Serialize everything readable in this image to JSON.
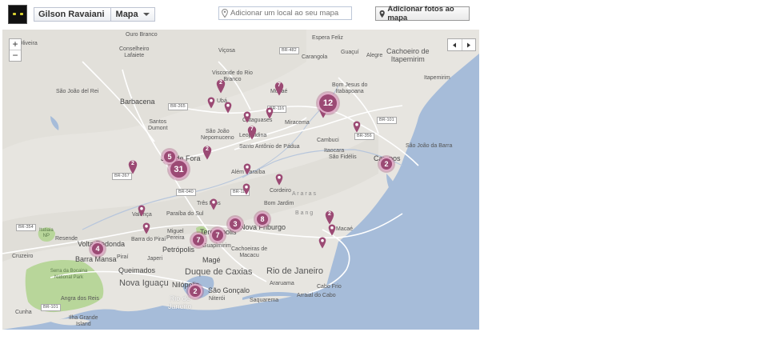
{
  "header": {
    "profile_name": "Gilson Ravaiani",
    "section_label": "Mapa",
    "search_placeholder": "Adicionar um local ao seu mapa",
    "add_photos_label": "Adicionar fotos ao mapa"
  },
  "map_controls": {
    "zoom_in": "+",
    "zoom_out": "−"
  },
  "map": {
    "labels": {
      "oliveira": "Oliveira",
      "ouro_branco": "Ouro Branco",
      "conselheiro_lafaiete": "Conselheiro\nLafaiete",
      "vicosa": "Viçosa",
      "visconde_do_rio_branco": "Visconde do Rio\nBranco",
      "espera_feliz": "Espera Feliz",
      "guacui": "Guaçuí",
      "alegre": "Alegre",
      "cachoeiro": "Cachoeiro de\nItapemirim",
      "itapemirim": "Itapemirim",
      "carangola": "Carangola",
      "sao_joao_del_rei": "São João del Rei",
      "barbacena": "Barbacena",
      "uba": "Ubá",
      "muriae": "Muriaé",
      "bom_jesus": "Bom Jesus do\nItabapoana",
      "santos_dumont": "Santos\nDumont",
      "cataguases": "Cataguases",
      "miracema": "Miracema",
      "sao_joao_nepomuceno": "São João\nNepomuceno",
      "leopoldina": "Leopoldina",
      "cambuci": "Cambuci",
      "santo_antonio_de_padua": "Santo Antônio de Pádua",
      "juiz_de_fora": "Juiz de Fora",
      "itaocara": "Itaocara",
      "sao_fidelis": "São Fidélis",
      "campos": "Campos",
      "sao_joao_da_barra": "São João da Barra",
      "alem_paraiba": "Além Paraíba",
      "cordeiro": "Cordeiro",
      "araras": "A r a r a s",
      "bom_jardim": "Bom Jardim",
      "tres_rios": "Três Rios",
      "valenca": "Valença",
      "paraiba_do_sul": "Paraíba do Sul",
      "itatiaia": "Itatiaia\nNP",
      "resende": "Resende",
      "volta_redonda": "Volta Redonda",
      "barra_do_pirai": "Barra do Piraí",
      "miguel_pereira": "Miguel\nPereira",
      "teresopolis": "Teresópolis",
      "nova_friburgo": "Nova Friburgo",
      "macae": "Macaé",
      "cruzeiro": "Cruzeiro",
      "barra_mansa": "Barra Mansa",
      "pirai": "Piraí",
      "petropolis": "Petrópolis",
      "guapimirim": "Guapimirim",
      "mage": "Magé",
      "cachoeiras_de_macacu": "Cachoeiras de\nMacacu",
      "japeri": "Japeri",
      "queimados": "Queimados",
      "serra_da_bocaina": "Serra da Bocaina National Park",
      "nova_iguacu": "Nova Iguaçu",
      "duque_de_caxias": "Duque de Caxias",
      "rio_de_janeiro": "Rio de Janeiro",
      "nilopolis": "Nilópolis",
      "sao_goncalo": "São Gonçalo",
      "niteroi": "Niterói",
      "arauama": "Araruama",
      "cabo_frio": "Cabo Frio",
      "rio_de_janeiro_bay": "Rio de\nJaneiro",
      "saquarema": "Saquarema",
      "arraial_do_cabo": "Arraial do Cabo",
      "cunha": "Cunha",
      "angra_dos_reis": "Angra dos Reis",
      "ilha_grande": "Ilha Grande\nIsland",
      "bang": "B a n g"
    },
    "highway_shields": {
      "br482": "BR-482",
      "br265": "BR-265",
      "br116a": "BR-116",
      "br101a": "BR-101",
      "br356": "BR-356",
      "br267": "BR-267",
      "br040": "BR-040",
      "br116b": "BR-116",
      "br354": "BR-354",
      "br101b": "BR-101"
    },
    "clusters": {
      "c12": "12",
      "c31": "31",
      "c5": "5",
      "c2_campos": "2",
      "c3": "3",
      "c8": "8",
      "c7a": "7",
      "c7b": "7",
      "c4": "4",
      "c2_rio": "2"
    },
    "pin_counts": {
      "p_uba": "2",
      "p_muriae": "7",
      "p_leopoldina": "7",
      "p_santos": "2",
      "p_jf_west": "2",
      "p_macae": "2"
    },
    "colors": {
      "land": "#e7e5e0",
      "water": "#a6bcd9",
      "park": "#b8d69a",
      "road": "#ffffff",
      "marker": "#9b4a74"
    }
  }
}
